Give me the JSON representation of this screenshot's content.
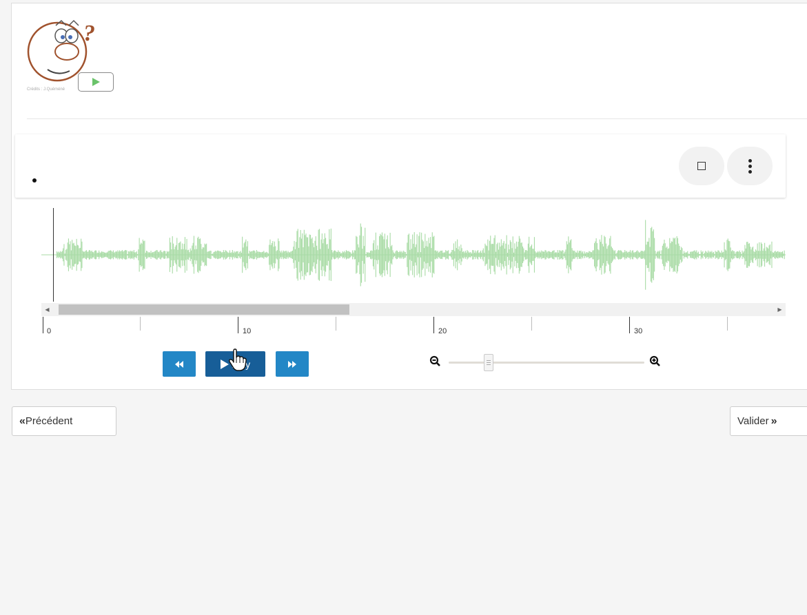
{
  "logo": {
    "question_mark": "?",
    "credits": "Crédits : J.Quéméné"
  },
  "card": {
    "square_button": "square-button",
    "more_button": "more-button"
  },
  "timeline": {
    "ticks": [
      "0",
      "10",
      "20",
      "30"
    ]
  },
  "player": {
    "play_label": "Play",
    "zoom_level": 0.22
  },
  "navigation": {
    "previous_label": "Précédent",
    "validate_label": "Valider"
  },
  "colors": {
    "waveform": "#a8dba5",
    "primary_button": "#2387c6",
    "play_button": "#175e98"
  }
}
